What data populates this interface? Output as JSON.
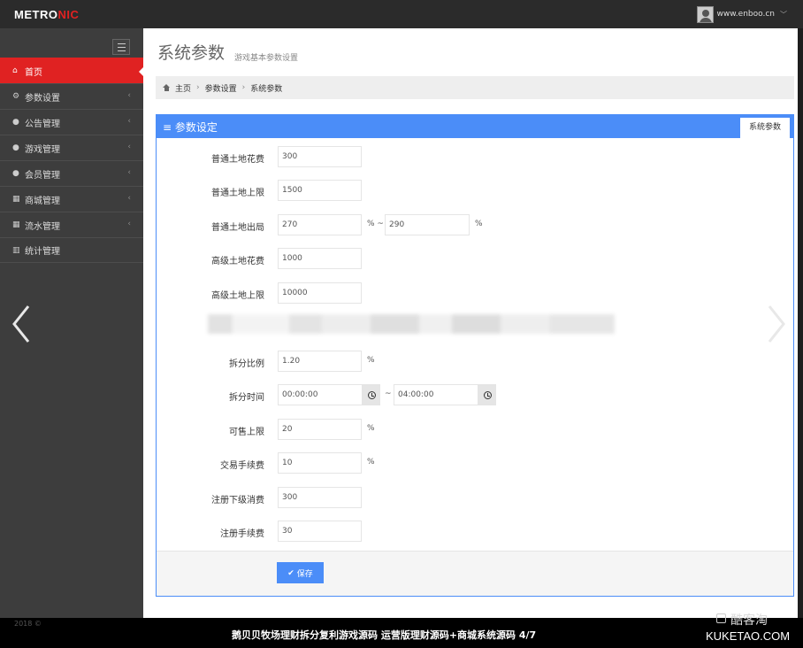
{
  "header": {
    "logo_main": "METRO",
    "logo_accent": "NIC",
    "username": "www.enboo.cn"
  },
  "sidebar": {
    "items": [
      {
        "label": "首页",
        "icon": "home-icon",
        "active": true
      },
      {
        "label": "参数设置",
        "icon": "cogs-icon"
      },
      {
        "label": "公告管理",
        "icon": "user-icon"
      },
      {
        "label": "游戏管理",
        "icon": "user-icon"
      },
      {
        "label": "会员管理",
        "icon": "user-icon"
      },
      {
        "label": "商城管理",
        "icon": "table-icon"
      },
      {
        "label": "流水管理",
        "icon": "table-icon"
      },
      {
        "label": "统计管理",
        "icon": "bar-chart-icon"
      }
    ]
  },
  "page": {
    "title": "系统参数",
    "subtitle": "游戏基本参数设置"
  },
  "breadcrumb": {
    "home": "主页",
    "level1": "参数设置",
    "level2": "系统参数"
  },
  "portlet": {
    "title": "参数设定",
    "tab": "系统参数"
  },
  "form": {
    "normal_land_cost": {
      "label": "普通土地花费",
      "value": "300"
    },
    "normal_land_limit": {
      "label": "普通土地上限",
      "value": "1500"
    },
    "normal_land_output": {
      "label": "普通土地出局",
      "value_from": "270",
      "unit_from": "% ~",
      "value_to": "290",
      "unit_to": "%"
    },
    "advanced_land_cost": {
      "label": "高级土地花费",
      "value": "1000"
    },
    "advanced_land_limit": {
      "label": "高级土地上限",
      "value": "10000"
    },
    "split_ratio": {
      "label": "拆分比例",
      "value": "1.20",
      "unit": "%"
    },
    "split_time": {
      "label": "拆分时间",
      "from": "00:00:00",
      "sep": "~",
      "to": "04:00:00"
    },
    "sell_limit": {
      "label": "可售上限",
      "value": "20",
      "unit": "%"
    },
    "trade_fee": {
      "label": "交易手续费",
      "value": "10",
      "unit": "%"
    },
    "register_sub_cost": {
      "label": "注册下级消费",
      "value": "300"
    },
    "register_fee": {
      "label": "注册手续费",
      "value": "30"
    }
  },
  "actions": {
    "save_label": "保存"
  },
  "footer": {
    "copyright": "2018 ©",
    "caption": "鹅贝贝牧场理财拆分复利游戏源码 运营版理财源码+商城系统源码   4/7",
    "watermark_name": "酷客淘",
    "watermark_domain": "KUKETAO.COM"
  },
  "colors": {
    "accent_red": "#e02222",
    "primary_blue": "#4b8df8",
    "sidebar_bg": "#3d3d3d"
  }
}
